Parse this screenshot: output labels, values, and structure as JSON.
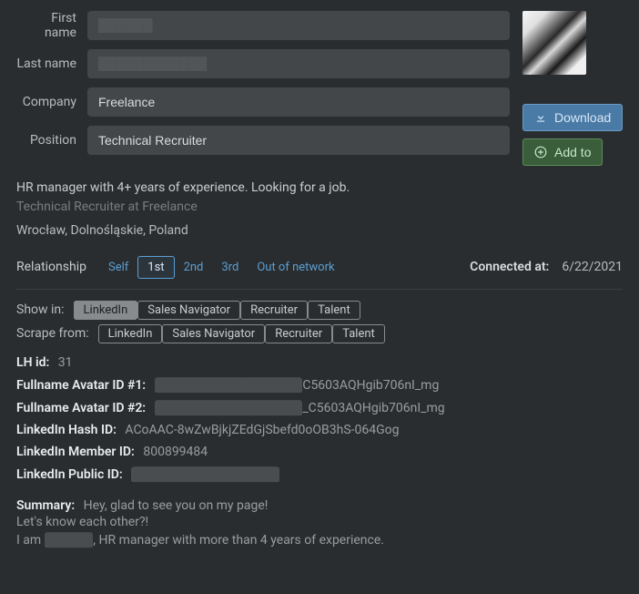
{
  "form": {
    "first_name_label": "First name",
    "first_name_value": "██████",
    "last_name_label": "Last name",
    "last_name_value": "████████████",
    "company_label": "Company",
    "company_value": "Freelance",
    "position_label": "Position",
    "position_value": "Technical Recruiter"
  },
  "actions": {
    "download_label": "Download",
    "addto_label": "Add to"
  },
  "headline": "HR manager with 4+ years of experience. Looking for a job.",
  "subhead": "Technical Recruiter at Freelance",
  "location": "Wrocław, Dolnośląskie, Poland",
  "relationship": {
    "label": "Relationship",
    "options": [
      "Self",
      "1st",
      "2nd",
      "3rd",
      "Out of network"
    ],
    "active": "1st",
    "connected_label": "Connected at:",
    "connected_date": "6/22/2021"
  },
  "show_in": {
    "label": "Show in:",
    "options": [
      "LinkedIn",
      "Sales Navigator",
      "Recruiter",
      "Talent"
    ],
    "active": "LinkedIn"
  },
  "scrape_from": {
    "label": "Scrape from:",
    "options": [
      "LinkedIn",
      "Sales Navigator",
      "Recruiter",
      "Talent"
    ]
  },
  "ids": {
    "lh": {
      "k": "LH id:",
      "v": "31"
    },
    "avatar1": {
      "k": "Fullname Avatar ID #1:",
      "red": "████████████████",
      "suffix": "C5603AQHgib706nI_mg"
    },
    "avatar2": {
      "k": "Fullname Avatar ID #2:",
      "red": "████████████████",
      "suffix": "_C5603AQHgib706nI_mg"
    },
    "hash": {
      "k": "LinkedIn Hash ID:",
      "v": "ACoAAC-8wZwBjkjZEdGjSbefd0oOB3hS-064Gog"
    },
    "member": {
      "k": "LinkedIn Member ID:",
      "v": "800899484"
    },
    "public": {
      "k": "LinkedIn Public ID:",
      "red": "████████████████"
    }
  },
  "summary": {
    "title": "Summary:",
    "line1": "Hey, glad to see you on my page!",
    "line2": "Let's know each other?!",
    "line3_pre": "I am ",
    "line3_red": "█████",
    "line3_post": ", HR manager with more than 4 years of experience."
  }
}
